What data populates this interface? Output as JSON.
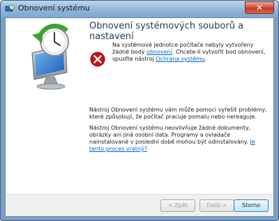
{
  "window": {
    "title": "Obnovení systému"
  },
  "main": {
    "heading": "Obnovení systémových souborů a nastavení",
    "error": {
      "text_part1": "Na systémové jednotce počítače nebyly vytvořeny žádné body",
      "link_restore_points": "obnovení",
      "text_part2": ". Chcete-li vytvořit bod obnovení, spusťte nástroj",
      "link_system_protection": "Ochrana systému",
      "text_part3": "."
    },
    "info1": "Nástroj Obnovení systému vám může pomoci vyřešit problémy, které způsobují, že počítač pracuje pomalu nebo nereaguje.",
    "info2": "Nástroj Obnovení systému neovlivňuje žádné dokumenty, obrázky ani jiná osobní data. Programy a ovladače nainstalované v poslední době mohou být odinstalovány.",
    "info2_link": "Je tento proces vratný?"
  },
  "buttons": {
    "back": "< Zpět",
    "next": "Další >",
    "cancel": "Storno"
  },
  "colors": {
    "heading": "#1e395b",
    "link": "#0066cc",
    "error_red": "#c8141c"
  },
  "icons": {
    "title": "system-restore-icon",
    "side": "system-restore-monitor-icon",
    "error": "error-icon",
    "close": "close-icon"
  }
}
